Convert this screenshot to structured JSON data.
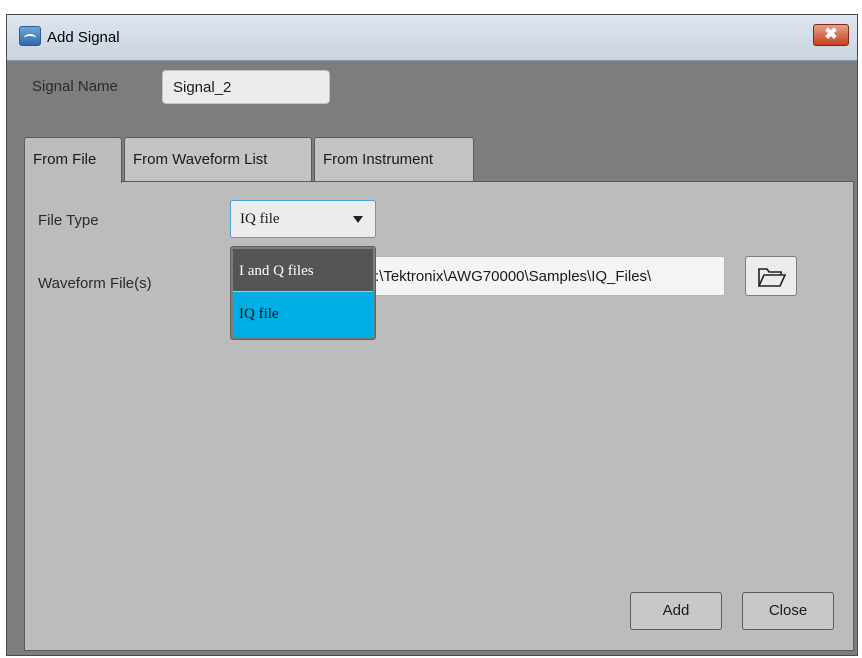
{
  "window": {
    "title": "Add Signal",
    "close_glyph": "✖"
  },
  "signal": {
    "label": "Signal Name",
    "value": "Signal_2"
  },
  "tabs": [
    {
      "label": "From File",
      "active": true
    },
    {
      "label": "From Waveform List",
      "active": false
    },
    {
      "label": "From Instrument",
      "active": false
    }
  ],
  "form": {
    "file_type_label": "File Type",
    "file_type_value": "IQ file",
    "waveform_label": "Waveform File(s)",
    "waveform_path": ":\\Tektronix\\AWG70000\\Samples\\IQ_Files\\"
  },
  "dropdown_options": [
    {
      "label": "I and Q files",
      "selected": false
    },
    {
      "label": "IQ file",
      "selected": true
    }
  ],
  "buttons": {
    "add": "Add",
    "close": "Close"
  },
  "icons": {
    "app": "add-signal-app-icon",
    "browse": "folder-open-icon",
    "dropdown": "triangle-down-icon",
    "close": "close-x-icon"
  },
  "colors": {
    "highlight": "#00aee6",
    "focus_border": "#4aa3d8",
    "close_red": "#c7401f"
  }
}
